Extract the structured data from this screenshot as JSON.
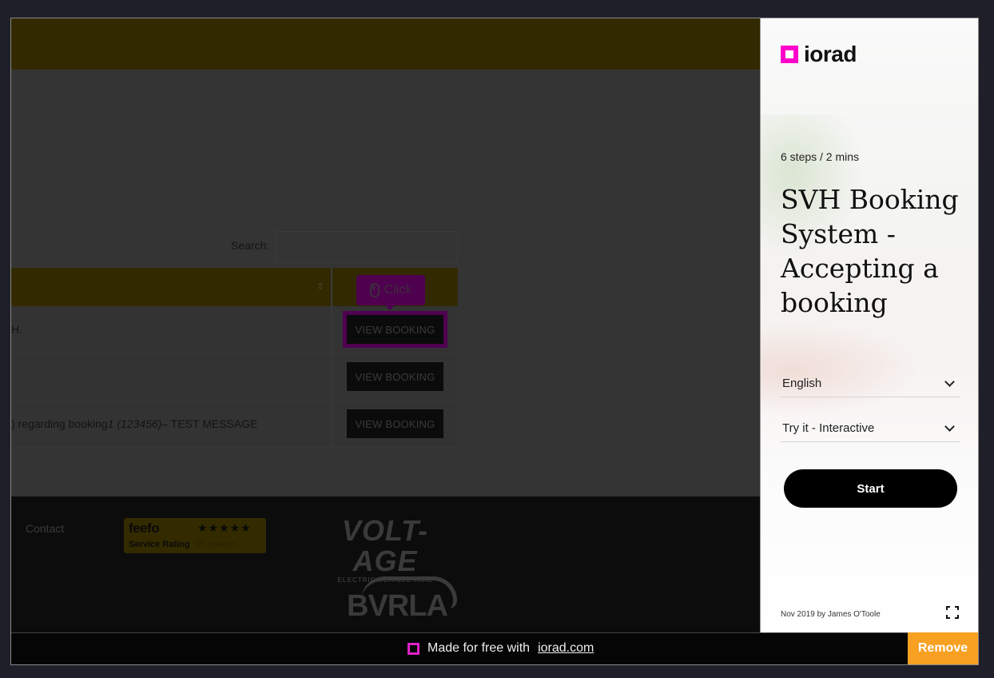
{
  "site": {
    "search": {
      "label": "Search:",
      "value": "",
      "placeholder": ""
    },
    "table": {
      "sort_icon": "sort-icon",
      "rows": [
        {
          "message_prefix": "H.",
          "message_italic": "",
          "message_suffix": "",
          "action_label": "VIEW BOOKING",
          "highlighted": true
        },
        {
          "message_prefix": "",
          "message_italic": "",
          "message_suffix": "",
          "action_label": "VIEW BOOKING",
          "highlighted": false
        },
        {
          "message_prefix": ") regarding booking ",
          "message_italic": "1 (123456)",
          "message_suffix": " – TEST MESSAGE",
          "action_label": "VIEW BOOKING",
          "highlighted": false
        }
      ]
    },
    "click_tooltip": {
      "icon": "mouse-icon",
      "label": "Click"
    },
    "footer": {
      "contact_label": "Contact",
      "feefo": {
        "logo": "feefo",
        "rating_label": "Service Rating",
        "stars": "★★★★★",
        "reviews": "55 reviews"
      },
      "voltage": {
        "logo": "VOLT-AGE",
        "subtitle": "ELECTRIC VEHICLE HIRE"
      },
      "bvrla": {
        "logo": "BVRLA"
      }
    }
  },
  "panel": {
    "brand": "iorad",
    "steps": "6 steps / 2 mins",
    "title": "SVH Booking System - Accepting a booking",
    "language": {
      "selected": "English"
    },
    "mode": {
      "selected": "Try it - Interactive"
    },
    "start_label": "Start",
    "byline": "Nov 2019 by James O'Toole"
  },
  "bottom_bar": {
    "made_with_text": "Made for free with",
    "made_with_link": "iorad.com",
    "remove_label": "Remove"
  },
  "colors": {
    "brand_pink": "#ff00cc",
    "remove_orange": "#f7a021",
    "header_yellow_dimmed": "#322900"
  }
}
